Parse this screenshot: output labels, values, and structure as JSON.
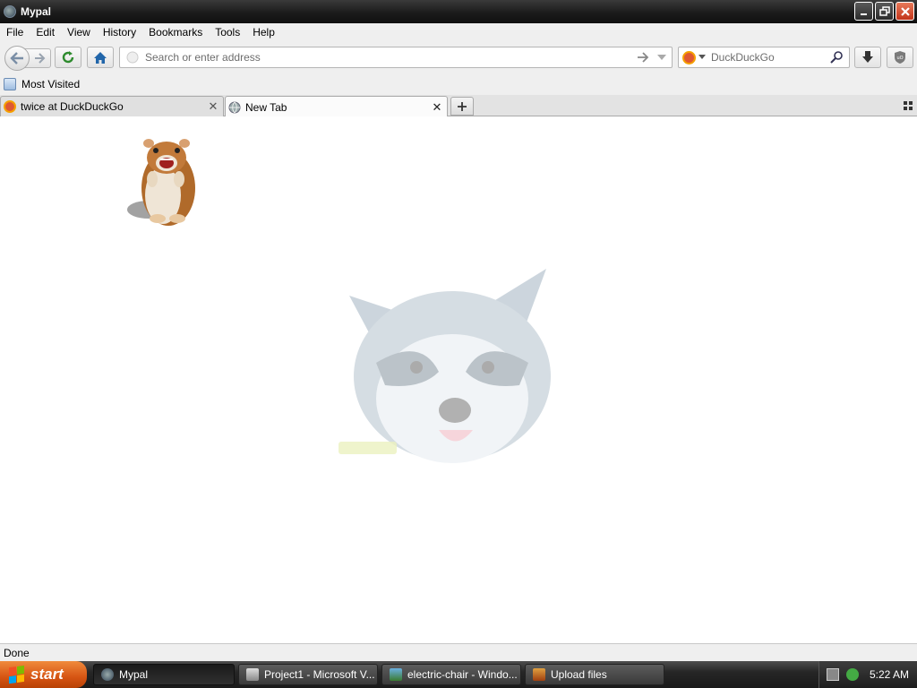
{
  "window": {
    "title": "Mypal"
  },
  "menu": [
    "File",
    "Edit",
    "View",
    "History",
    "Bookmarks",
    "Tools",
    "Help"
  ],
  "nav": {
    "url_placeholder": "Search or enter address",
    "search_placeholder": "DuckDuckGo"
  },
  "bookmarks": {
    "most_visited": "Most Visited"
  },
  "tabs": [
    {
      "label": "twice at DuckDuckGo",
      "active": false
    },
    {
      "label": "New Tab",
      "active": true
    }
  ],
  "status": {
    "text": "Done"
  },
  "taskbar": {
    "start_label": "start",
    "tasks": [
      {
        "label": "Mypal",
        "active": true
      },
      {
        "label": "Project1 - Microsoft V...",
        "active": false
      },
      {
        "label": "electric-chair - Windo...",
        "active": false
      },
      {
        "label": "Upload files",
        "active": false
      }
    ],
    "clock": "5:22 AM"
  },
  "colors": {
    "accent_start": "#d65413",
    "ddg_orange": "#de5833",
    "home_blue": "#2266aa",
    "reload_green": "#2e8b2e"
  }
}
